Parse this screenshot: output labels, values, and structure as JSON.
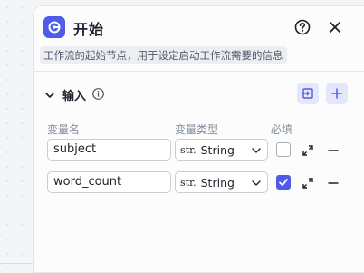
{
  "node": {
    "title": "开始",
    "description": "工作流的起始节点，用于设定启动工作流需要的信息",
    "accent_color": "#4e5ce8"
  },
  "header_icons": {
    "node_icon": "start-node-icon",
    "help_icon": "help-circle-icon",
    "close_icon": "close-icon"
  },
  "input_section": {
    "title": "输入",
    "info_icon": "info-icon",
    "expanded": true,
    "import_icon": "import-icon",
    "add_icon": "plus-icon"
  },
  "columns": {
    "name": "变量名",
    "type": "变量类型",
    "required": "必填"
  },
  "rows": [
    {
      "name": "subject",
      "type_prefix": "str.",
      "type_label": "String",
      "required": false
    },
    {
      "name": "word_count",
      "type_prefix": "str.",
      "type_label": "String",
      "required": true
    }
  ]
}
